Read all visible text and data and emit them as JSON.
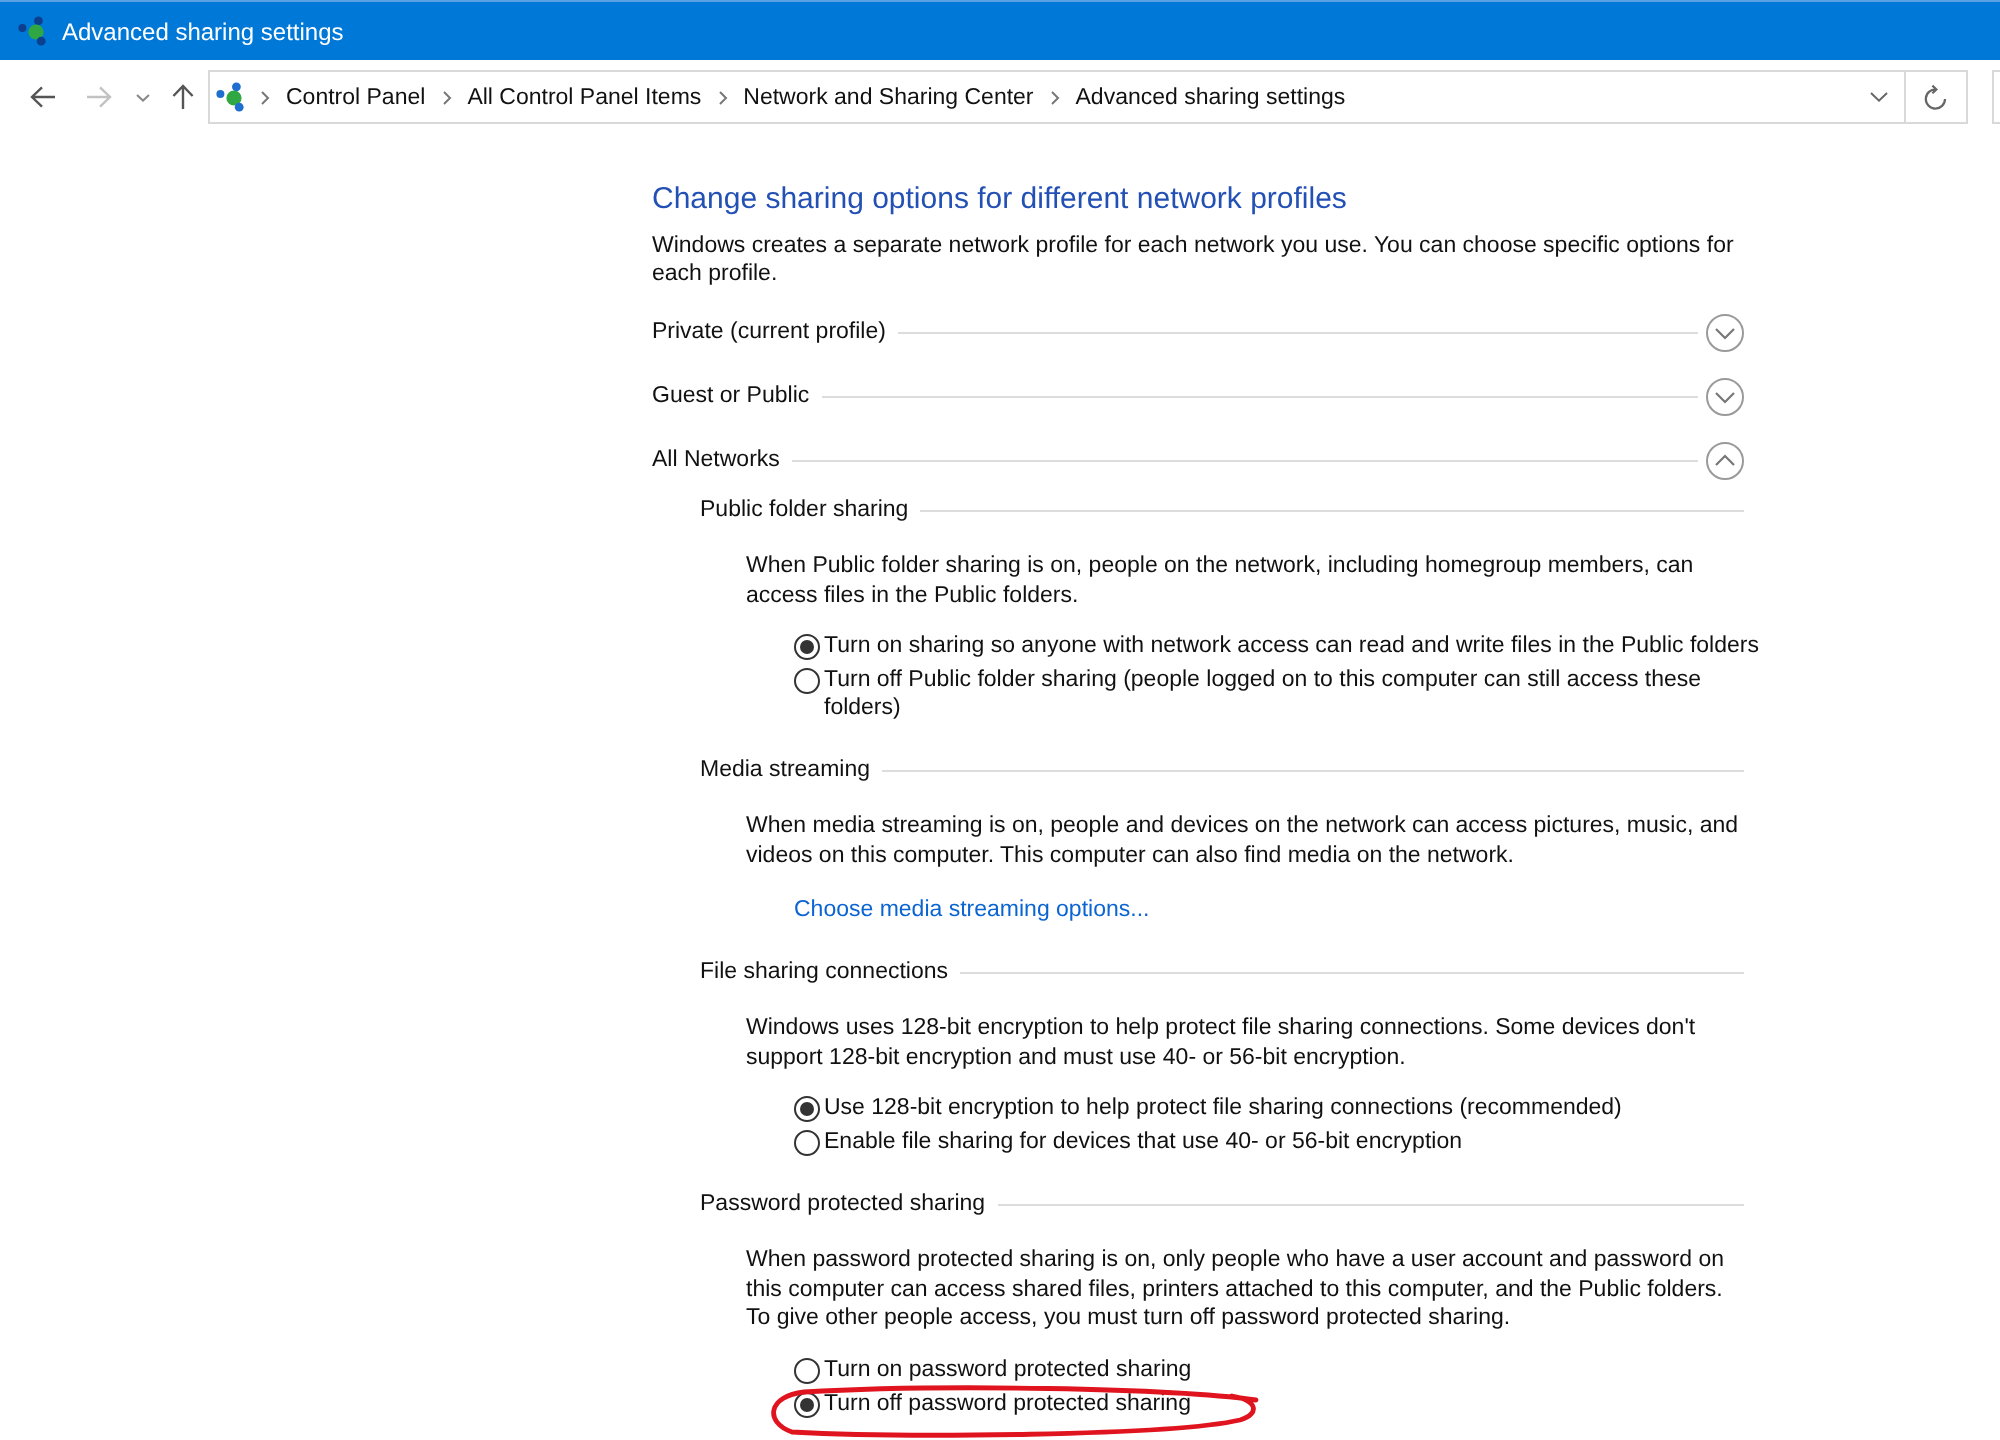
{
  "window": {
    "title": "Advanced sharing settings"
  },
  "nav_buttons": [
    {
      "kind": "back",
      "disabled": false
    },
    {
      "kind": "forward",
      "disabled": true
    },
    {
      "kind": "recent",
      "disabled": false
    },
    {
      "kind": "up",
      "disabled": false
    }
  ],
  "address_bar": {
    "breadcrumb": [
      "Control Panel",
      "All Control Panel Items",
      "Network and Sharing Center",
      "Advanced sharing settings"
    ]
  },
  "heading": "Change sharing options for different network profiles",
  "description": "Windows creates a separate network profile for each network you use. You can choose specific options for each profile.",
  "profiles": [
    {
      "label": "Private (current profile)",
      "expanded": false
    },
    {
      "label": "Guest or Public",
      "expanded": false
    },
    {
      "label": "All Networks",
      "expanded": true,
      "sections": [
        {
          "title": "Public folder sharing",
          "description": "When Public folder sharing is on, people on the network, including homegroup members, can access files in the Public folders.",
          "kind": "radios",
          "options": [
            {
              "label": "Turn on sharing so anyone with network access can read and write files in the Public folders",
              "selected": true,
              "circled": false
            },
            {
              "label": "Turn off Public folder sharing (people logged on to this computer can still access these folders)",
              "selected": false,
              "circled": false
            }
          ]
        },
        {
          "title": "Media streaming",
          "description": "When media streaming is on, people and devices on the network can access pictures, music, and videos on this computer. This computer can also find media on the network.",
          "kind": "link",
          "link": "Choose media streaming options..."
        },
        {
          "title": "File sharing connections",
          "description": "Windows uses 128-bit encryption to help protect file sharing connections. Some devices don't support 128-bit encryption and must use 40- or 56-bit encryption.",
          "kind": "radios",
          "options": [
            {
              "label": "Use 128-bit encryption to help protect file sharing connections (recommended)",
              "selected": true,
              "circled": false
            },
            {
              "label": "Enable file sharing for devices that use 40- or 56-bit encryption",
              "selected": false,
              "circled": false
            }
          ]
        },
        {
          "title": "Password protected sharing",
          "description": "When password protected sharing is on, only people who have a user account and password on this computer can access shared files, printers attached to this computer, and the Public folders. To give other people access, you must turn off password protected sharing.",
          "kind": "radios",
          "options": [
            {
              "label": "Turn on password protected sharing",
              "selected": false,
              "circled": false
            },
            {
              "label": "Turn off password protected sharing",
              "selected": true,
              "circled": true
            }
          ]
        }
      ]
    }
  ]
}
